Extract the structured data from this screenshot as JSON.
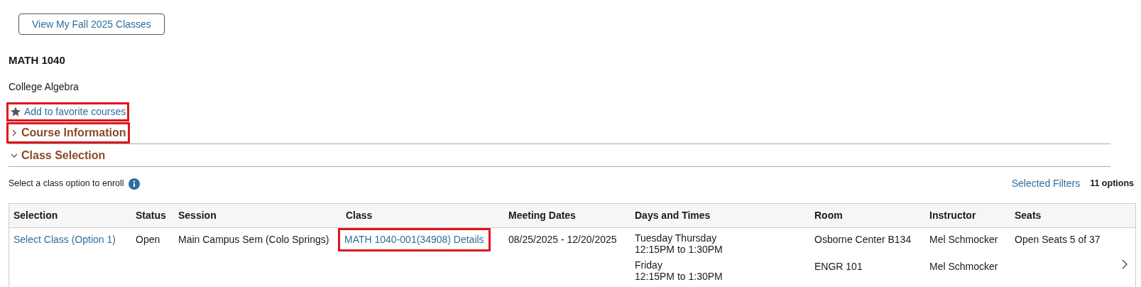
{
  "top_button": {
    "label": "View My Fall 2025 Classes"
  },
  "course": {
    "code": "MATH 1040",
    "title": "College Algebra"
  },
  "favorite_link": {
    "label": "Add to favorite courses",
    "highlighted": true
  },
  "sections": [
    {
      "label": "Course Information",
      "expanded": false,
      "highlighted": true
    },
    {
      "label": "Class Selection",
      "expanded": true,
      "highlighted": false
    }
  ],
  "instruction": "Select a class option to enroll",
  "filters_link": "Selected Filters",
  "options_count": "11 options",
  "table": {
    "columns": [
      "Selection",
      "Status",
      "Session",
      "Class",
      "Meeting Dates",
      "Days and Times",
      "Room",
      "Instructor",
      "Seats"
    ],
    "rows": [
      {
        "selection": "Select Class (Option 1)",
        "status": "Open",
        "session": "Main Campus Sem (Colo Springs)",
        "class": "MATH 1040-001(34908) Details",
        "class_highlighted": true,
        "dates": "08/25/2025 - 12/20/2025",
        "seats": "Open Seats 5 of 37",
        "meetings": [
          {
            "days": "Tuesday Thursday",
            "times": "12:15PM to 1:30PM",
            "room": "Osborne Center B134",
            "instructor": "Mel Schmocker"
          },
          {
            "days": "Friday",
            "times": "12:15PM to 1:30PM",
            "room": "ENGR 101",
            "instructor": "Mel Schmocker"
          }
        ]
      }
    ]
  }
}
